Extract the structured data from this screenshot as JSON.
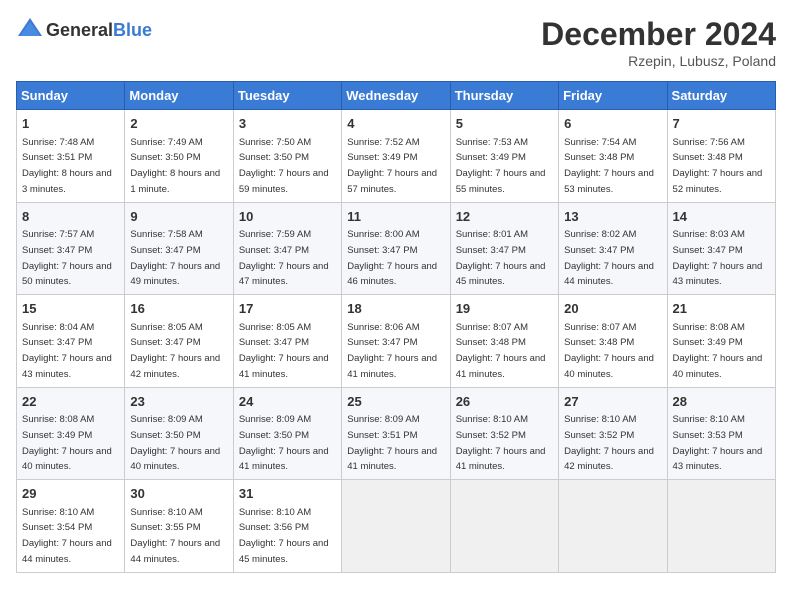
{
  "header": {
    "logo_general": "General",
    "logo_blue": "Blue",
    "month": "December 2024",
    "location": "Rzepin, Lubusz, Poland"
  },
  "weekdays": [
    "Sunday",
    "Monday",
    "Tuesday",
    "Wednesday",
    "Thursday",
    "Friday",
    "Saturday"
  ],
  "weeks": [
    [
      {
        "day": "1",
        "sunrise": "Sunrise: 7:48 AM",
        "sunset": "Sunset: 3:51 PM",
        "daylight": "Daylight: 8 hours and 3 minutes."
      },
      {
        "day": "2",
        "sunrise": "Sunrise: 7:49 AM",
        "sunset": "Sunset: 3:50 PM",
        "daylight": "Daylight: 8 hours and 1 minute."
      },
      {
        "day": "3",
        "sunrise": "Sunrise: 7:50 AM",
        "sunset": "Sunset: 3:50 PM",
        "daylight": "Daylight: 7 hours and 59 minutes."
      },
      {
        "day": "4",
        "sunrise": "Sunrise: 7:52 AM",
        "sunset": "Sunset: 3:49 PM",
        "daylight": "Daylight: 7 hours and 57 minutes."
      },
      {
        "day": "5",
        "sunrise": "Sunrise: 7:53 AM",
        "sunset": "Sunset: 3:49 PM",
        "daylight": "Daylight: 7 hours and 55 minutes."
      },
      {
        "day": "6",
        "sunrise": "Sunrise: 7:54 AM",
        "sunset": "Sunset: 3:48 PM",
        "daylight": "Daylight: 7 hours and 53 minutes."
      },
      {
        "day": "7",
        "sunrise": "Sunrise: 7:56 AM",
        "sunset": "Sunset: 3:48 PM",
        "daylight": "Daylight: 7 hours and 52 minutes."
      }
    ],
    [
      {
        "day": "8",
        "sunrise": "Sunrise: 7:57 AM",
        "sunset": "Sunset: 3:47 PM",
        "daylight": "Daylight: 7 hours and 50 minutes."
      },
      {
        "day": "9",
        "sunrise": "Sunrise: 7:58 AM",
        "sunset": "Sunset: 3:47 PM",
        "daylight": "Daylight: 7 hours and 49 minutes."
      },
      {
        "day": "10",
        "sunrise": "Sunrise: 7:59 AM",
        "sunset": "Sunset: 3:47 PM",
        "daylight": "Daylight: 7 hours and 47 minutes."
      },
      {
        "day": "11",
        "sunrise": "Sunrise: 8:00 AM",
        "sunset": "Sunset: 3:47 PM",
        "daylight": "Daylight: 7 hours and 46 minutes."
      },
      {
        "day": "12",
        "sunrise": "Sunrise: 8:01 AM",
        "sunset": "Sunset: 3:47 PM",
        "daylight": "Daylight: 7 hours and 45 minutes."
      },
      {
        "day": "13",
        "sunrise": "Sunrise: 8:02 AM",
        "sunset": "Sunset: 3:47 PM",
        "daylight": "Daylight: 7 hours and 44 minutes."
      },
      {
        "day": "14",
        "sunrise": "Sunrise: 8:03 AM",
        "sunset": "Sunset: 3:47 PM",
        "daylight": "Daylight: 7 hours and 43 minutes."
      }
    ],
    [
      {
        "day": "15",
        "sunrise": "Sunrise: 8:04 AM",
        "sunset": "Sunset: 3:47 PM",
        "daylight": "Daylight: 7 hours and 43 minutes."
      },
      {
        "day": "16",
        "sunrise": "Sunrise: 8:05 AM",
        "sunset": "Sunset: 3:47 PM",
        "daylight": "Daylight: 7 hours and 42 minutes."
      },
      {
        "day": "17",
        "sunrise": "Sunrise: 8:05 AM",
        "sunset": "Sunset: 3:47 PM",
        "daylight": "Daylight: 7 hours and 41 minutes."
      },
      {
        "day": "18",
        "sunrise": "Sunrise: 8:06 AM",
        "sunset": "Sunset: 3:47 PM",
        "daylight": "Daylight: 7 hours and 41 minutes."
      },
      {
        "day": "19",
        "sunrise": "Sunrise: 8:07 AM",
        "sunset": "Sunset: 3:48 PM",
        "daylight": "Daylight: 7 hours and 41 minutes."
      },
      {
        "day": "20",
        "sunrise": "Sunrise: 8:07 AM",
        "sunset": "Sunset: 3:48 PM",
        "daylight": "Daylight: 7 hours and 40 minutes."
      },
      {
        "day": "21",
        "sunrise": "Sunrise: 8:08 AM",
        "sunset": "Sunset: 3:49 PM",
        "daylight": "Daylight: 7 hours and 40 minutes."
      }
    ],
    [
      {
        "day": "22",
        "sunrise": "Sunrise: 8:08 AM",
        "sunset": "Sunset: 3:49 PM",
        "daylight": "Daylight: 7 hours and 40 minutes."
      },
      {
        "day": "23",
        "sunrise": "Sunrise: 8:09 AM",
        "sunset": "Sunset: 3:50 PM",
        "daylight": "Daylight: 7 hours and 40 minutes."
      },
      {
        "day": "24",
        "sunrise": "Sunrise: 8:09 AM",
        "sunset": "Sunset: 3:50 PM",
        "daylight": "Daylight: 7 hours and 41 minutes."
      },
      {
        "day": "25",
        "sunrise": "Sunrise: 8:09 AM",
        "sunset": "Sunset: 3:51 PM",
        "daylight": "Daylight: 7 hours and 41 minutes."
      },
      {
        "day": "26",
        "sunrise": "Sunrise: 8:10 AM",
        "sunset": "Sunset: 3:52 PM",
        "daylight": "Daylight: 7 hours and 41 minutes."
      },
      {
        "day": "27",
        "sunrise": "Sunrise: 8:10 AM",
        "sunset": "Sunset: 3:52 PM",
        "daylight": "Daylight: 7 hours and 42 minutes."
      },
      {
        "day": "28",
        "sunrise": "Sunrise: 8:10 AM",
        "sunset": "Sunset: 3:53 PM",
        "daylight": "Daylight: 7 hours and 43 minutes."
      }
    ],
    [
      {
        "day": "29",
        "sunrise": "Sunrise: 8:10 AM",
        "sunset": "Sunset: 3:54 PM",
        "daylight": "Daylight: 7 hours and 44 minutes."
      },
      {
        "day": "30",
        "sunrise": "Sunrise: 8:10 AM",
        "sunset": "Sunset: 3:55 PM",
        "daylight": "Daylight: 7 hours and 44 minutes."
      },
      {
        "day": "31",
        "sunrise": "Sunrise: 8:10 AM",
        "sunset": "Sunset: 3:56 PM",
        "daylight": "Daylight: 7 hours and 45 minutes."
      },
      null,
      null,
      null,
      null
    ]
  ]
}
